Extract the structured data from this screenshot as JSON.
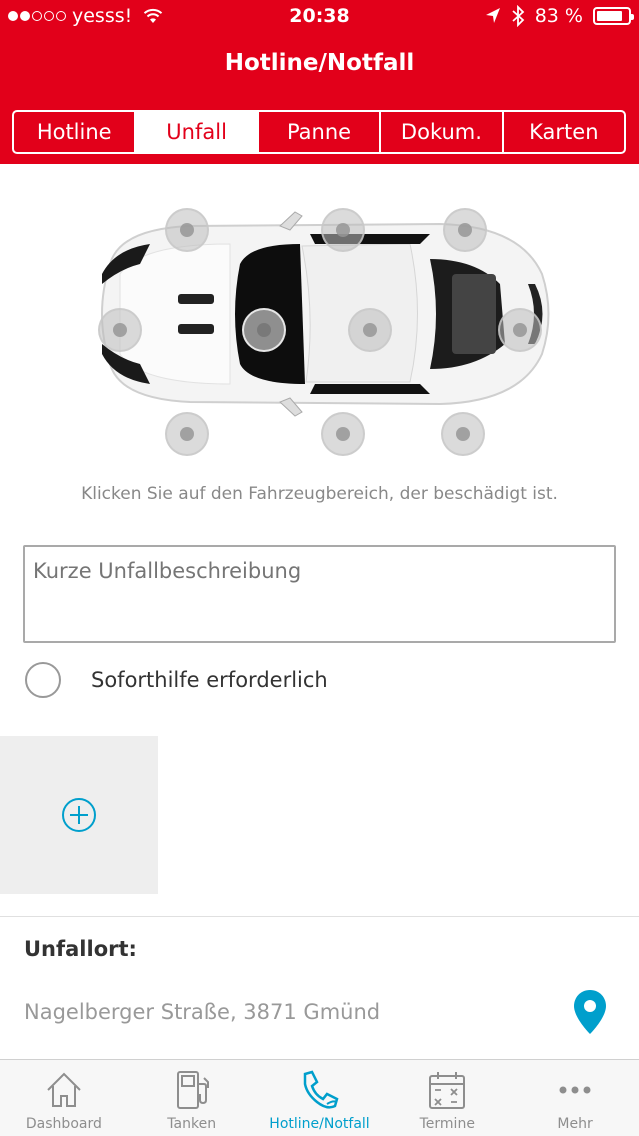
{
  "status_bar": {
    "carrier": "yesss!",
    "time": "20:38",
    "battery": "83 %",
    "battery_level": 0.83
  },
  "header": {
    "title": "Hotline/Notfall"
  },
  "tabs": [
    {
      "label": "Hotline",
      "active": false
    },
    {
      "label": "Unfall",
      "active": true
    },
    {
      "label": "Panne",
      "active": false
    },
    {
      "label": "Dokum.",
      "active": false
    },
    {
      "label": "Karten",
      "active": false
    }
  ],
  "damage": {
    "hint": "Klicken Sie auf den Fahrzeugbereich, der beschädigt ist."
  },
  "form": {
    "description_placeholder": "Kurze Unfallbeschreibung",
    "immediate_help_label": "Soforthilfe erforderlich"
  },
  "location": {
    "label": "Unfallort:",
    "value": "Nagelberger Straße, 3871 Gmünd"
  },
  "tabbar": [
    {
      "label": "Dashboard",
      "icon": "house-icon",
      "active": false
    },
    {
      "label": "Tanken",
      "icon": "fuel-pump-icon",
      "active": false
    },
    {
      "label": "Hotline/Notfall",
      "icon": "phone-icon",
      "active": true
    },
    {
      "label": "Termine",
      "icon": "calendar-icon",
      "active": false
    },
    {
      "label": "Mehr",
      "icon": "more-icon",
      "active": false
    }
  ],
  "colors": {
    "brand_red": "#e2001a",
    "accent_blue": "#009fcc"
  }
}
